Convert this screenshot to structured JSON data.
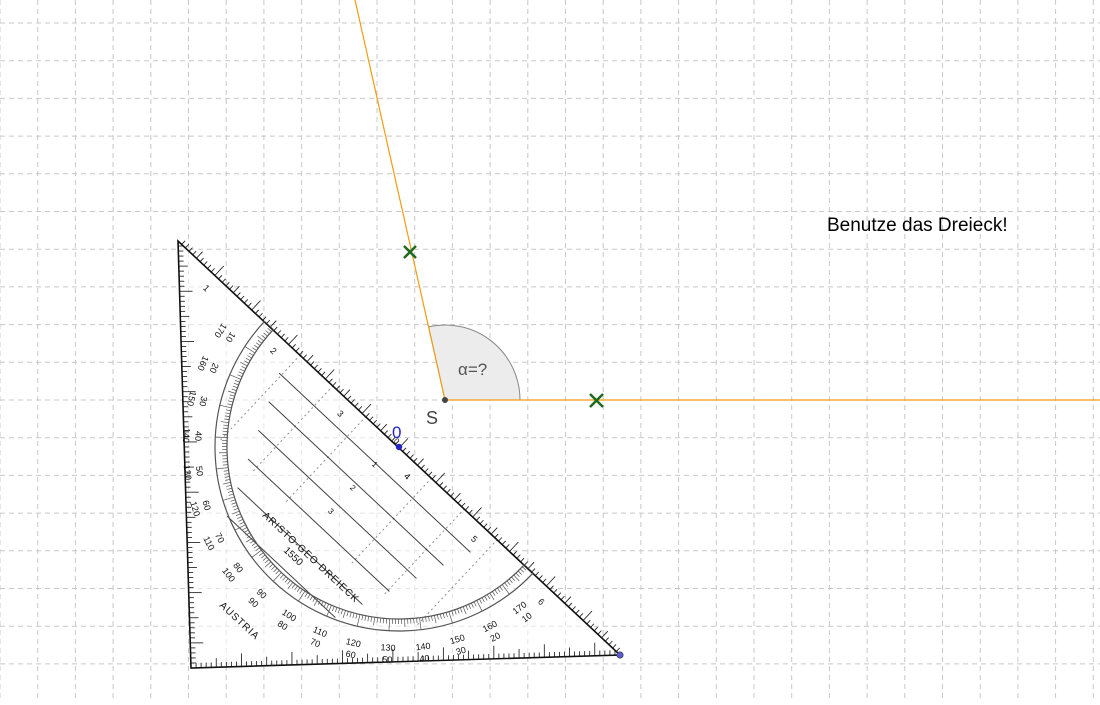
{
  "app": {
    "instruction_text": "Benutze das Dreieck!"
  },
  "construction": {
    "vertex_label": "S",
    "angle_label": "α=?",
    "triangle_zero_label": "0",
    "ray_color": "#f39c12",
    "marker_color": "#1e6b1e",
    "angle_fill": "#ececec",
    "point_color": "#3b3bd9"
  },
  "set_square": {
    "brand_line1": "ARISTO-GEO DREIECK",
    "brand_line2": "1550",
    "country": "AUSTRIA",
    "ruler_numbers": [
      "1",
      "2",
      "3",
      "4",
      "5",
      "6"
    ],
    "inner_numbers": [
      "0",
      "1",
      "2",
      "3"
    ],
    "outer_degrees": [
      "170",
      "160",
      "150",
      "140",
      "130",
      "120",
      "110",
      "100",
      "90",
      "80",
      "70",
      "60",
      "50",
      "40",
      "30",
      "20",
      "10"
    ],
    "inner_degrees": [
      "10",
      "20",
      "30",
      "40",
      "50",
      "60",
      "70",
      "80",
      "90",
      "100",
      "110",
      "120",
      "130",
      "140",
      "150",
      "160",
      "170"
    ]
  }
}
